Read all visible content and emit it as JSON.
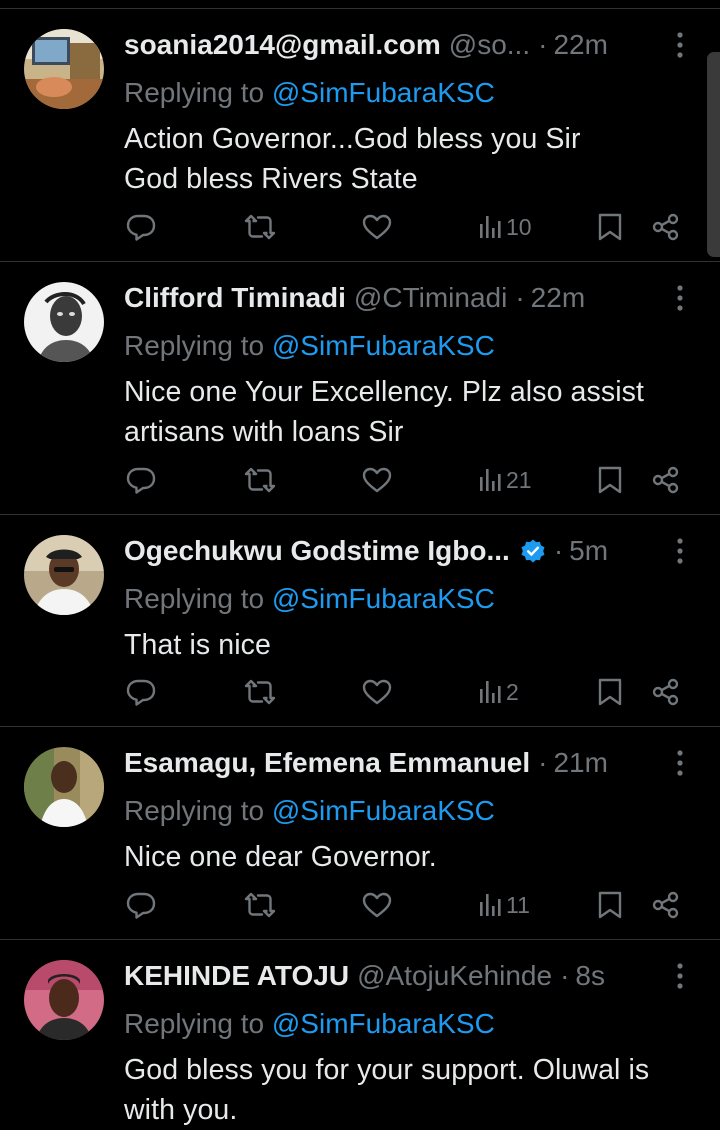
{
  "colors": {
    "background": "#000000",
    "primary_text": "#e7e9ea",
    "secondary_text": "#71767b",
    "link": "#1d9bf0",
    "divider": "#2f3336",
    "verified": "#1d9bf0"
  },
  "icons": {
    "reply": "speech-bubble-icon",
    "repost": "repost-arrows-icon",
    "like": "heart-icon",
    "views": "bar-chart-icon",
    "bookmark": "bookmark-icon",
    "share": "share-nodes-icon",
    "more": "vertical-dots-icon",
    "verified": "verified-badge-icon"
  },
  "replies": [
    {
      "name": "soania2014@gmail.com",
      "handle": "@so...",
      "separator": "·",
      "time": "22m",
      "verified": false,
      "replying_prefix": "Replying to",
      "replying_to": "@SimFubaraKSC",
      "text": "Action Governor...God bless you Sir God bless Rivers State",
      "views": "10"
    },
    {
      "name": "Clifford Timinadi",
      "handle": "@CTiminadi",
      "separator": "·",
      "time": "22m",
      "verified": false,
      "replying_prefix": "Replying to",
      "replying_to": "@SimFubaraKSC",
      "text": "Nice one Your Excellency. Plz also assist artisans with loans Sir",
      "views": "21"
    },
    {
      "name": "Ogechukwu Godstime Igbo...",
      "handle": "",
      "separator": "·",
      "time": "5m",
      "verified": true,
      "replying_prefix": "Replying to",
      "replying_to": "@SimFubaraKSC",
      "text": "That is nice",
      "views": "2"
    },
    {
      "name": "Esamagu, Efemena Emmanuel",
      "handle": "",
      "separator": "·",
      "time": "21m",
      "verified": false,
      "replying_prefix": "Replying to",
      "replying_to": "@SimFubaraKSC",
      "text": "Nice one dear Governor.",
      "views": "11"
    },
    {
      "name": "KEHINDE ATOJU",
      "handle": "@AtojuKehinde",
      "separator": "·",
      "time": "8s",
      "verified": false,
      "replying_prefix": "Replying to",
      "replying_to": "@SimFubaraKSC",
      "text": "God bless you for your support. Oluwal is with you.",
      "views": ""
    }
  ]
}
